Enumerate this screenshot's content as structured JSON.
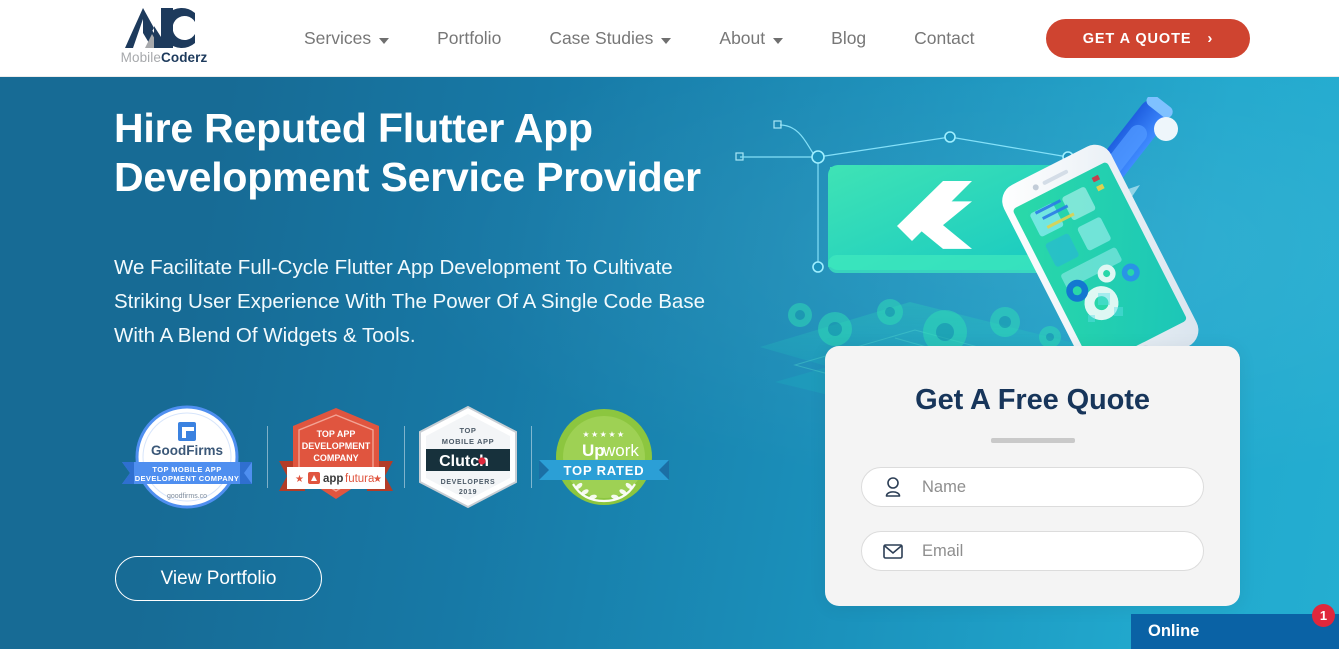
{
  "header": {
    "logo": {
      "mark_icon": "mc-monogram-logo",
      "word_part1": "Mobile",
      "word_part2": "Coderz"
    },
    "nav": [
      {
        "label": "Services",
        "has_dropdown": true
      },
      {
        "label": "Portfolio",
        "has_dropdown": false
      },
      {
        "label": "Case Studies",
        "has_dropdown": true
      },
      {
        "label": "About",
        "has_dropdown": true
      },
      {
        "label": "Blog",
        "has_dropdown": false
      },
      {
        "label": "Contact",
        "has_dropdown": false
      }
    ],
    "cta": {
      "label": "GET A QUOTE",
      "chevron": "›",
      "color": "#cf4430"
    }
  },
  "hero": {
    "title": "Hire Reputed Flutter App Development Service Provider",
    "subtitle": "We Facilitate Full-Cycle Flutter App Development To Cultivate Striking User Experience With The Power Of A Single Code Base With A Blend Of Widgets & Tools.",
    "portfolio_button": "View Portfolio",
    "bg_left_color": "#176b95",
    "bg_right_color": "#24aed1",
    "illustration_icon": "flutter-app-development-illustration",
    "badges": [
      {
        "id": "goodfirms",
        "name_icon": "goodfirms-badge",
        "brand": "GoodFirms",
        "ribbon_line1": "TOP MOBILE APP",
        "ribbon_line2": "DEVELOPMENT COMPANY",
        "footer": "goodfirms.co",
        "color": "#3b82e0"
      },
      {
        "id": "appfutura",
        "name_icon": "appfutura-badge",
        "line1": "TOP APP",
        "line2": "DEVELOPMENT",
        "line3": "COMPANY",
        "brand": "appfutura",
        "color": "#e0553f"
      },
      {
        "id": "clutch",
        "name_icon": "clutch-badge",
        "top1": "TOP",
        "top2": "MOBILE APP",
        "brand": "Clutch",
        "bottom1": "DEVELOPERS",
        "bottom2": "2019",
        "color": "#17313c"
      },
      {
        "id": "upwork",
        "name_icon": "upwork-badge",
        "stars": "★★★★★",
        "brand_up": "Up",
        "brand_work": "work",
        "ribbon": "TOP RATED",
        "color": "#8cc63f"
      }
    ]
  },
  "quote_form": {
    "title": "Get A Free Quote",
    "fields": [
      {
        "icon": "user-icon",
        "placeholder": "Name",
        "value": ""
      },
      {
        "icon": "envelope-icon",
        "placeholder": "Email",
        "value": ""
      }
    ]
  },
  "chat_widget": {
    "status_label": "Online",
    "unread_count": "1",
    "bar_color": "#0a62a5",
    "badge_color": "#e0273c"
  }
}
